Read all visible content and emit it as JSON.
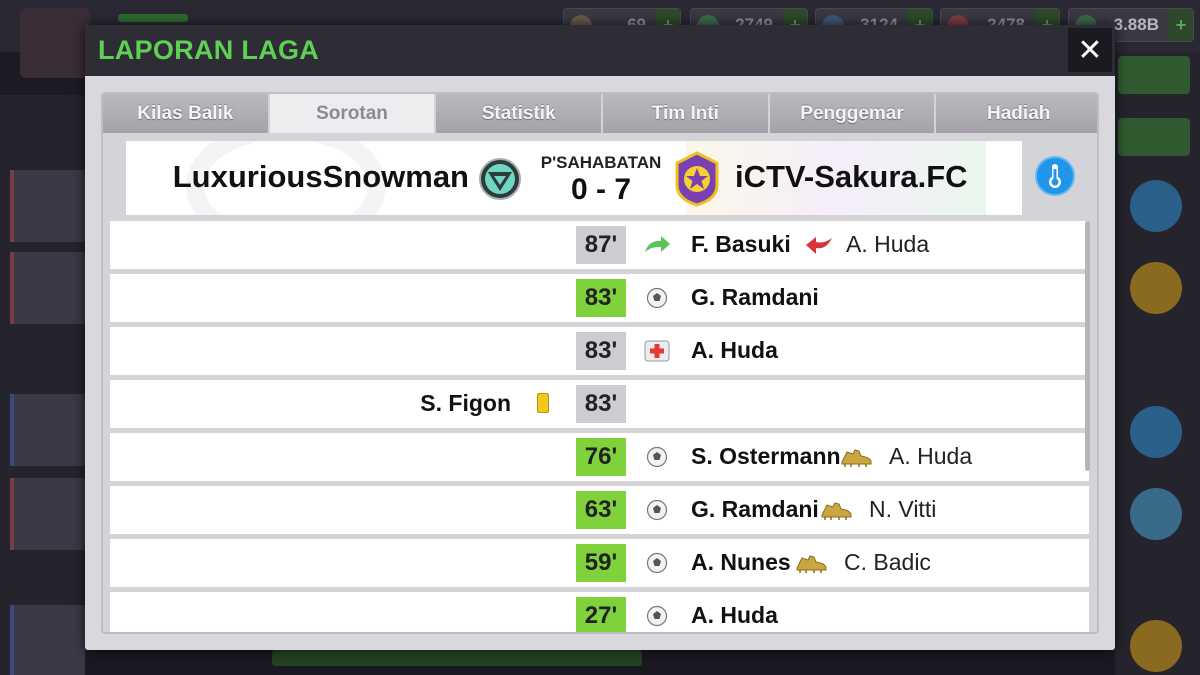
{
  "background": {
    "resources": [
      {
        "value": "69",
        "icon": "coin-icon"
      },
      {
        "value": "2749",
        "icon": "training-icon"
      },
      {
        "value": "3124",
        "icon": "boost-icon"
      },
      {
        "value": "2478",
        "icon": "medical-icon"
      },
      {
        "value": "3.88B",
        "icon": "money-icon"
      }
    ],
    "plus_label": "+"
  },
  "modal": {
    "title": "LAPORAN LAGA",
    "close_label": "✕",
    "tabs": [
      "Kilas Balik",
      "Sorotan",
      "Statistik",
      "Tim Inti",
      "Penggemar",
      "Hadiah"
    ],
    "active_tab": "Sorotan"
  },
  "match": {
    "home_team": "LuxuriousSnowman",
    "away_team": "iCTV-Sakura.FC",
    "match_type": "P'SAHABATAN",
    "score": "0 - 7"
  },
  "events": [
    {
      "minute": "87'",
      "type": "substitution",
      "icon": "substitution-in-icon",
      "player": "F. Basuki",
      "secondary_icon": "substitution-out-icon",
      "secondary": "A. Huda",
      "side": "away"
    },
    {
      "minute": "83'",
      "type": "goal",
      "icon": "ball-icon",
      "player": "G. Ramdani",
      "secondary_icon": "",
      "secondary": "",
      "side": "away"
    },
    {
      "minute": "83'",
      "type": "injury",
      "icon": "injury-icon",
      "player": "A. Huda",
      "secondary_icon": "",
      "secondary": "",
      "side": "away"
    },
    {
      "minute": "83'",
      "type": "yellow_card",
      "icon": "yellow-card-icon",
      "player": "S. Figon",
      "secondary_icon": "",
      "secondary": "",
      "side": "home"
    },
    {
      "minute": "76'",
      "type": "goal",
      "icon": "ball-icon",
      "player": "S. Ostermann",
      "secondary_icon": "assist-boot-icon",
      "secondary": "A. Huda",
      "side": "away"
    },
    {
      "minute": "63'",
      "type": "goal",
      "icon": "ball-icon",
      "player": "G. Ramdani",
      "secondary_icon": "assist-boot-icon",
      "secondary": "N. Vitti",
      "side": "away"
    },
    {
      "minute": "59'",
      "type": "goal",
      "icon": "ball-icon",
      "player": "A. Nunes",
      "secondary_icon": "assist-boot-icon",
      "secondary": "C. Badic",
      "side": "away"
    },
    {
      "minute": "27'",
      "type": "goal",
      "icon": "ball-icon",
      "player": "A. Huda",
      "secondary_icon": "",
      "secondary": "",
      "side": "away"
    }
  ],
  "colors": {
    "title_green": "#5ed054",
    "goal_minute": "#7fd23c",
    "neutral_minute": "#cdcdd1",
    "yellow_card": "#f2c81c",
    "weather_blue": "#2196e9"
  }
}
